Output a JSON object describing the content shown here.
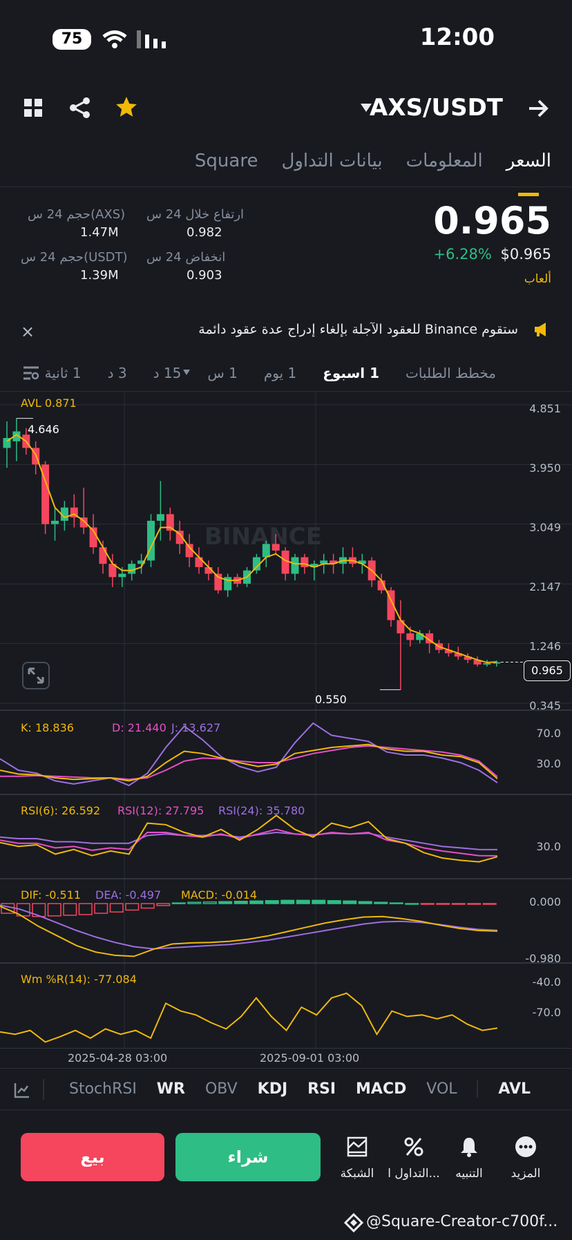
{
  "status": {
    "battery": "75",
    "time": "12:00"
  },
  "header": {
    "pair": "AXS/USDT",
    "star_color": "#f0b90b"
  },
  "tabs": [
    "السعر",
    "المعلومات",
    "بيانات التداول",
    "Square"
  ],
  "price": {
    "last": "0.965",
    "change": "+6.28%",
    "usd": "$0.965",
    "tag": "ألعاب",
    "high_label": "ارتفاع خلال 24 س",
    "high_value": "0.982",
    "low_label": "انخفاض 24 س",
    "low_value": "0.903",
    "vol_axs_label": "حجم 24 س(AXS)",
    "vol_axs_value": "1.47M",
    "vol_usdt_label": "حجم 24 س(USDT)",
    "vol_usdt_value": "1.39M"
  },
  "notice": {
    "text": "ستقوم Binance للعقود الآجلة بإلغاء إدراج عدة عقود دائمة",
    "close": "×"
  },
  "intervals": [
    "1 ثانية",
    "3 د",
    "15 د",
    "1 س",
    "1 يوم",
    "1 اسبوع",
    "مخطط الطلبات"
  ],
  "chart": {
    "avl": "AVL 0.871",
    "axis": [
      "4.851",
      "3.950",
      "3.049",
      "2.147",
      "1.246",
      "0.345"
    ],
    "high_mark": "4.646",
    "low_mark": "0.550",
    "current": "0.965",
    "watermark": "BINANCE",
    "dates": [
      "2025-04-28 03:00",
      "2025-09-01 03:00"
    ],
    "kdj": {
      "k": "K: 18.836",
      "d": "D: 21.440",
      "j": "J: 13.627",
      "axis": [
        "70.0",
        "30.0"
      ]
    },
    "rsi": {
      "r6": "RSI(6): 26.592",
      "r12": "RSI(12): 27.795",
      "r24": "RSI(24): 35.780",
      "axis": "30.0"
    },
    "macd": {
      "dif": "DIF: -0.511",
      "dea": "DEA: -0.497",
      "macd": "MACD: -0.014",
      "axis": [
        "0.000",
        "-0.980"
      ]
    },
    "wr": {
      "label": "Wm %R(14): -77.084",
      "axis": [
        "-40.0",
        "-70.0"
      ]
    }
  },
  "chart_data": {
    "type": "candlestick",
    "pair": "AXS/USDT",
    "interval": "1 اسبوع",
    "ylim": [
      0.345,
      4.851
    ],
    "ohlc": [
      [
        4.2,
        4.6,
        3.9,
        4.35
      ],
      [
        4.3,
        4.646,
        4.0,
        4.45
      ],
      [
        4.4,
        4.5,
        4.1,
        4.2
      ],
      [
        4.2,
        4.3,
        3.8,
        3.95
      ],
      [
        3.95,
        4.0,
        2.9,
        3.05
      ],
      [
        3.05,
        3.3,
        2.8,
        3.1
      ],
      [
        3.1,
        3.4,
        2.95,
        3.3
      ],
      [
        3.3,
        3.5,
        3.0,
        3.15
      ],
      [
        3.15,
        3.6,
        2.9,
        3.0
      ],
      [
        3.0,
        3.2,
        2.6,
        2.7
      ],
      [
        2.7,
        2.8,
        2.3,
        2.45
      ],
      [
        2.45,
        2.6,
        2.1,
        2.25
      ],
      [
        2.25,
        2.4,
        2.1,
        2.3
      ],
      [
        2.3,
        2.5,
        2.2,
        2.45
      ],
      [
        2.45,
        2.6,
        2.3,
        2.5
      ],
      [
        2.5,
        3.2,
        2.4,
        3.1
      ],
      [
        3.1,
        3.7,
        2.8,
        3.2
      ],
      [
        3.2,
        3.3,
        2.8,
        2.95
      ],
      [
        2.95,
        3.1,
        2.6,
        2.75
      ],
      [
        2.75,
        2.9,
        2.4,
        2.55
      ],
      [
        2.55,
        2.7,
        2.3,
        2.4
      ],
      [
        2.4,
        2.5,
        2.2,
        2.3
      ],
      [
        2.3,
        2.4,
        2.0,
        2.05
      ],
      [
        2.05,
        2.3,
        1.95,
        2.25
      ],
      [
        2.25,
        2.3,
        2.1,
        2.15
      ],
      [
        2.15,
        2.4,
        2.1,
        2.35
      ],
      [
        2.35,
        2.6,
        2.3,
        2.55
      ],
      [
        2.55,
        2.8,
        2.4,
        2.75
      ],
      [
        2.75,
        2.9,
        2.6,
        2.65
      ],
      [
        2.65,
        2.7,
        2.2,
        2.3
      ],
      [
        2.3,
        2.6,
        2.2,
        2.55
      ],
      [
        2.55,
        2.6,
        2.3,
        2.4
      ],
      [
        2.4,
        2.5,
        2.2,
        2.45
      ],
      [
        2.45,
        2.6,
        2.3,
        2.5
      ],
      [
        2.5,
        2.6,
        2.3,
        2.45
      ],
      [
        2.45,
        2.7,
        2.3,
        2.55
      ],
      [
        2.55,
        2.7,
        2.4,
        2.45
      ],
      [
        2.45,
        2.6,
        2.3,
        2.5
      ],
      [
        2.5,
        2.55,
        2.1,
        2.2
      ],
      [
        2.2,
        2.3,
        2.0,
        2.05
      ],
      [
        2.05,
        2.1,
        1.5,
        1.6
      ],
      [
        1.6,
        1.9,
        0.55,
        1.4
      ],
      [
        1.4,
        1.5,
        1.2,
        1.3
      ],
      [
        1.3,
        1.45,
        1.25,
        1.4
      ],
      [
        1.4,
        1.45,
        1.1,
        1.25
      ],
      [
        1.25,
        1.3,
        1.1,
        1.15
      ],
      [
        1.15,
        1.25,
        1.05,
        1.1
      ],
      [
        1.1,
        1.2,
        1.0,
        1.05
      ],
      [
        1.05,
        1.1,
        0.95,
        1.0
      ],
      [
        1.0,
        1.05,
        0.9,
        0.93
      ],
      [
        0.93,
        1.0,
        0.9,
        0.95
      ],
      [
        0.95,
        0.99,
        0.9,
        0.965
      ]
    ],
    "ma": [
      4.3,
      4.4,
      4.3,
      4.1,
      3.7,
      3.3,
      3.15,
      3.2,
      3.1,
      2.95,
      2.7,
      2.45,
      2.35,
      2.35,
      2.4,
      2.7,
      3.0,
      3.0,
      2.9,
      2.7,
      2.55,
      2.4,
      2.25,
      2.2,
      2.2,
      2.25,
      2.4,
      2.55,
      2.6,
      2.5,
      2.45,
      2.45,
      2.4,
      2.45,
      2.45,
      2.5,
      2.5,
      2.45,
      2.35,
      2.2,
      1.9,
      1.6,
      1.45,
      1.4,
      1.3,
      1.2,
      1.15,
      1.1,
      1.05,
      1.0,
      0.96,
      0.97
    ],
    "kdj": {
      "k": [
        30,
        25,
        24,
        20,
        18,
        19,
        20,
        16,
        22,
        40,
        55,
        52,
        46,
        40,
        35,
        38,
        52,
        56,
        60,
        62,
        64,
        58,
        55,
        55,
        50,
        48,
        40,
        18.836
      ],
      "d": [
        22,
        22,
        23,
        22,
        21,
        20,
        20,
        18,
        20,
        30,
        42,
        46,
        45,
        42,
        40,
        40,
        46,
        52,
        56,
        60,
        62,
        60,
        58,
        56,
        54,
        50,
        42,
        21.44
      ],
      "j": [
        45,
        30,
        26,
        16,
        12,
        16,
        20,
        10,
        26,
        60,
        88,
        70,
        48,
        35,
        28,
        34,
        66,
        92,
        76,
        72,
        68,
        54,
        50,
        50,
        46,
        40,
        30,
        13.627
      ]
    },
    "rsi": {
      "r6": [
        45,
        40,
        42,
        30,
        36,
        28,
        34,
        30,
        70,
        68,
        58,
        52,
        62,
        48,
        62,
        80,
        62,
        52,
        70,
        64,
        72,
        50,
        44,
        32,
        25,
        22,
        20,
        26.592
      ],
      "r12": [
        48,
        44,
        44,
        38,
        40,
        35,
        38,
        36,
        58,
        58,
        54,
        52,
        56,
        50,
        56,
        62,
        56,
        54,
        58,
        56,
        58,
        48,
        44,
        38,
        34,
        31,
        28,
        27.795
      ],
      "r24": [
        52,
        50,
        50,
        46,
        46,
        44,
        44,
        44,
        54,
        56,
        54,
        54,
        55,
        52,
        55,
        58,
        56,
        55,
        57,
        56,
        57,
        52,
        48,
        44,
        40,
        38,
        36,
        35.78
      ]
    },
    "macd": {
      "dif": [
        -0.05,
        -0.2,
        -0.42,
        -0.6,
        -0.78,
        -0.9,
        -0.96,
        -0.98,
        -0.85,
        -0.75,
        -0.73,
        -0.72,
        -0.7,
        -0.66,
        -0.6,
        -0.52,
        -0.44,
        -0.36,
        -0.3,
        -0.25,
        -0.24,
        -0.28,
        -0.33,
        -0.4,
        -0.46,
        -0.5,
        -0.511
      ],
      "dea": [
        -0.03,
        -0.1,
        -0.22,
        -0.36,
        -0.5,
        -0.62,
        -0.72,
        -0.8,
        -0.84,
        -0.82,
        -0.8,
        -0.78,
        -0.76,
        -0.72,
        -0.68,
        -0.62,
        -0.56,
        -0.5,
        -0.44,
        -0.38,
        -0.34,
        -0.33,
        -0.35,
        -0.39,
        -0.44,
        -0.48,
        -0.497
      ],
      "hist": [
        -0.3,
        -0.38,
        -0.4,
        -0.38,
        -0.36,
        -0.34,
        -0.3,
        -0.26,
        -0.2,
        -0.14,
        -0.06,
        0.02,
        0.04,
        0.05,
        0.06,
        0.07,
        0.08,
        0.09,
        0.1,
        0.1,
        0.1,
        0.09,
        0.08,
        0.06,
        0.04,
        0.02,
        0.0,
        -0.01,
        -0.02,
        -0.02,
        -0.02,
        -0.014
      ]
    },
    "wr": [
      -82,
      -85,
      -80,
      -95,
      -88,
      -80,
      -90,
      -78,
      -85,
      -80,
      -90,
      -45,
      -55,
      -60,
      -70,
      -78,
      -62,
      -38,
      -62,
      -80,
      -50,
      -60,
      -38,
      -32,
      -48,
      -85,
      -55,
      -62,
      -60,
      -65,
      -60,
      -72,
      -80,
      -77.084
    ]
  },
  "indicator_tabs": [
    "AVL",
    "VOL",
    "MACD",
    "RSI",
    "KDJ",
    "OBV",
    "WR",
    "StochRSI"
  ],
  "bottom": {
    "more": "المزيد",
    "alert": "التنبيه",
    "trade": "التداول ا...",
    "grid": "الشبكة",
    "buy": "شراء",
    "sell": "بيع",
    "buy_color": "#2ebd85",
    "sell_color": "#f6465d"
  },
  "footer": {
    "credit": "@Square-Creator-c700f..."
  }
}
